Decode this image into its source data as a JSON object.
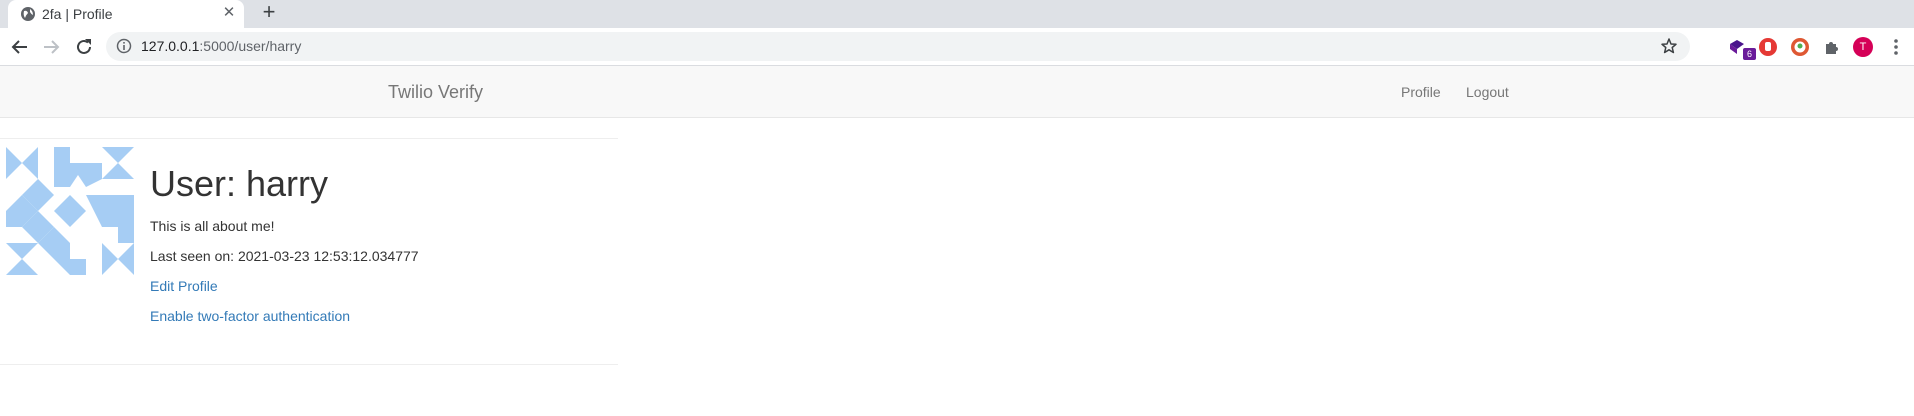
{
  "browser": {
    "tab_title": "2fa | Profile",
    "url_host": "127.0.0.1",
    "url_rest": ":5000/user/harry",
    "extension_badge": "6",
    "profile_initial": "T"
  },
  "navbar": {
    "brand": "Twilio Verify",
    "links": [
      "Profile",
      "Logout"
    ]
  },
  "profile": {
    "title": "User: harry",
    "about": "This is all about me!",
    "last_seen": "Last seen on: 2021-03-23 12:53:12.034777",
    "edit_link": "Edit Profile",
    "two_factor_link": "Enable two-factor authentication"
  },
  "colors": {
    "identicon": "#a6cdf4",
    "link": "#337ab7",
    "avatar": "#d50057"
  }
}
